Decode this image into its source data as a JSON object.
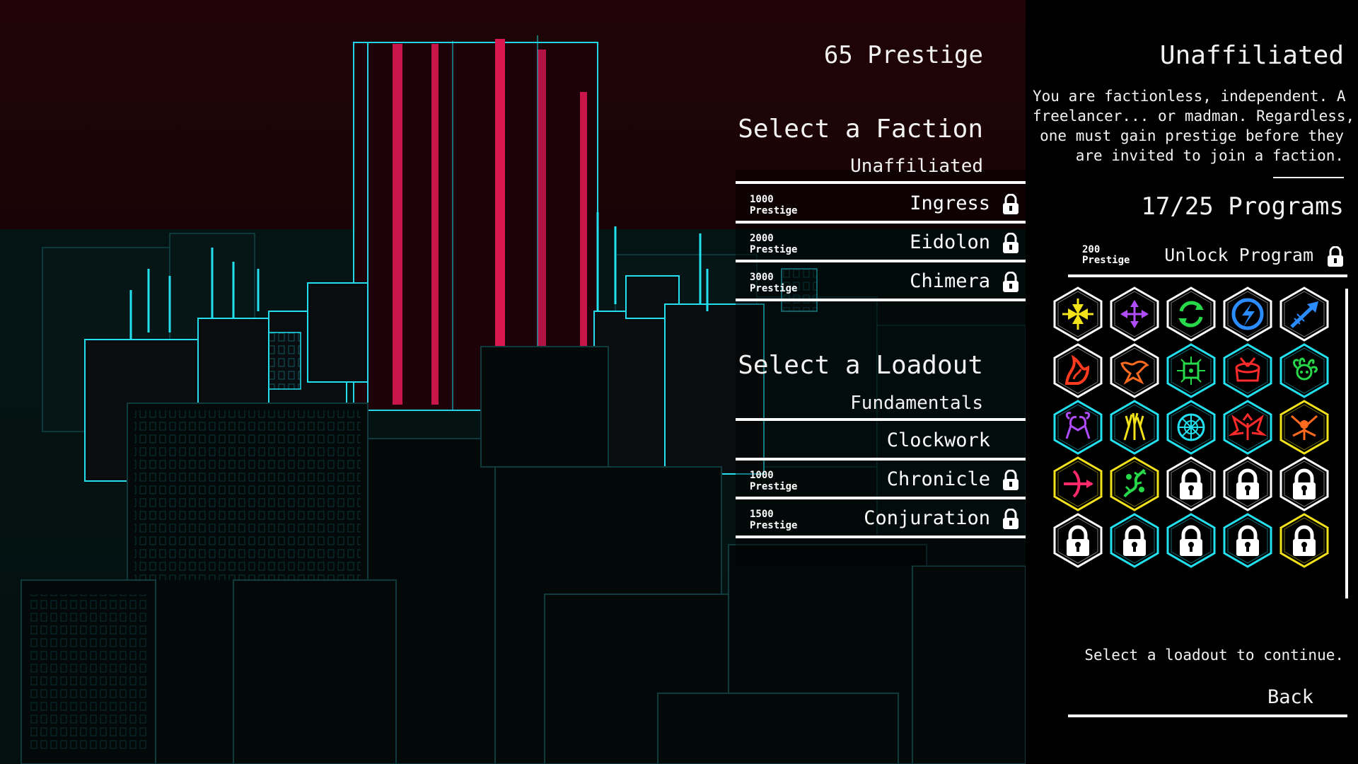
{
  "prestige": "65 Prestige",
  "faction_section": {
    "heading": "Select a Faction",
    "current": "Unaffiliated",
    "items": [
      {
        "cost": "1000",
        "cost_unit": "Prestige",
        "label": "Ingress",
        "locked": true
      },
      {
        "cost": "2000",
        "cost_unit": "Prestige",
        "label": "Eidolon",
        "locked": true
      },
      {
        "cost": "3000",
        "cost_unit": "Prestige",
        "label": "Chimera",
        "locked": true
      }
    ]
  },
  "loadout_section": {
    "heading": "Select a Loadout",
    "current": "Fundamentals",
    "items": [
      {
        "cost": "",
        "cost_unit": "",
        "label": "Clockwork",
        "locked": false
      },
      {
        "cost": "1000",
        "cost_unit": "Prestige",
        "label": "Chronicle",
        "locked": true
      },
      {
        "cost": "1500",
        "cost_unit": "Prestige",
        "label": "Conjuration",
        "locked": true
      }
    ]
  },
  "detail": {
    "title": "Unaffiliated",
    "description_lines": [
      "You are factionless, independent. A",
      "freelancer... or madman. Regardless,",
      "one must gain prestige before they",
      "are invited to join a faction."
    ],
    "programs_count": "17/25 Programs",
    "unlock": {
      "cost": "200",
      "cost_unit": "Prestige",
      "label": "Unlock Program"
    },
    "hint": "Select a loadout to continue.",
    "back_label": "Back"
  },
  "colors": {
    "white": "#ffffff",
    "purple": "#b04dff",
    "cyan": "#22e0f0",
    "yellow": "#f2e21a",
    "red": "#ff3b1f",
    "green": "#27d84a",
    "blue": "#2a8cff"
  },
  "programs": [
    {
      "icon": "four-arrows-in-icon",
      "border": "#ffffff",
      "color": "#f2e21a",
      "locked": false
    },
    {
      "icon": "four-arrows-out-icon",
      "border": "#ffffff",
      "color": "#b04dff",
      "locked": false
    },
    {
      "icon": "cycle-arrows-icon",
      "border": "#ffffff",
      "color": "#27d84a",
      "locked": false
    },
    {
      "icon": "lightning-shield-icon",
      "border": "#ffffff",
      "color": "#2a8cff",
      "locked": false
    },
    {
      "icon": "arrow-dash-icon",
      "border": "#ffffff",
      "color": "#2a8cff",
      "locked": false
    },
    {
      "icon": "flame-icon",
      "border": "#ffffff",
      "color": "#ff3b1f",
      "locked": false
    },
    {
      "icon": "phoenix-icon",
      "border": "#ffffff",
      "color": "#ff6a1f",
      "locked": false
    },
    {
      "icon": "circuit-chip-icon",
      "border": "#22e0f0",
      "color": "#27d84a",
      "locked": false
    },
    {
      "icon": "war-drum-icon",
      "border": "#22e0f0",
      "color": "#ff2a2a",
      "locked": false
    },
    {
      "icon": "medusa-icon",
      "border": "#22e0f0",
      "color": "#27d84a",
      "locked": false
    },
    {
      "icon": "twin-goats-icon",
      "border": "#22e0f0",
      "color": "#b04dff",
      "locked": false
    },
    {
      "icon": "reaching-hands-icon",
      "border": "#22e0f0",
      "color": "#f2e21a",
      "locked": false
    },
    {
      "icon": "web-globe-icon",
      "border": "#22e0f0",
      "color": "#22e0f0",
      "locked": false
    },
    {
      "icon": "demon-wings-icon",
      "border": "#22e0f0",
      "color": "#ff2a2a",
      "locked": false
    },
    {
      "icon": "bird-burst-icon",
      "border": "#f2e21a",
      "color": "#ff6a1f",
      "locked": false
    },
    {
      "icon": "crossbow-icon",
      "border": "#f2e21a",
      "color": "#ff2a6a",
      "locked": false
    },
    {
      "icon": "thorn-vine-icon",
      "border": "#f2e21a",
      "color": "#27d84a",
      "locked": false
    },
    {
      "icon": "lock-icon",
      "border": "#ffffff",
      "color": "#ffffff",
      "locked": true
    },
    {
      "icon": "lock-icon",
      "border": "#ffffff",
      "color": "#ffffff",
      "locked": true
    },
    {
      "icon": "lock-icon",
      "border": "#ffffff",
      "color": "#ffffff",
      "locked": true
    },
    {
      "icon": "lock-icon",
      "border": "#ffffff",
      "color": "#ffffff",
      "locked": true
    },
    {
      "icon": "lock-icon",
      "border": "#22e0f0",
      "color": "#ffffff",
      "locked": true
    },
    {
      "icon": "lock-icon",
      "border": "#22e0f0",
      "color": "#ffffff",
      "locked": true
    },
    {
      "icon": "lock-icon",
      "border": "#22e0f0",
      "color": "#ffffff",
      "locked": true
    },
    {
      "icon": "lock-icon",
      "border": "#f2e21a",
      "color": "#ffffff",
      "locked": true
    }
  ]
}
